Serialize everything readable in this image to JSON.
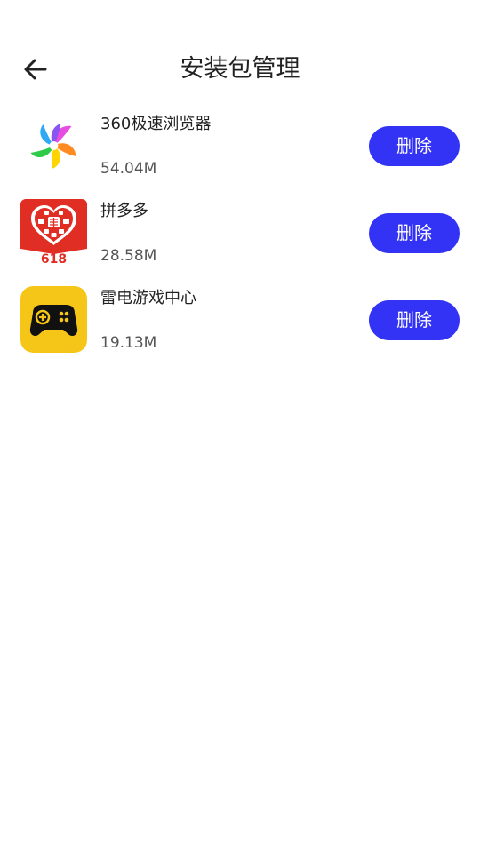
{
  "header": {
    "title": "安装包管理",
    "back_icon": "arrow-left-icon"
  },
  "colors": {
    "accent": "#3333f5",
    "pdd_red": "#e02e24",
    "ld_yellow": "#f5c518"
  },
  "apps": [
    {
      "name": "360极速浏览器",
      "size": "54.04M",
      "icon": "browser-360-icon",
      "action_label": "删除"
    },
    {
      "name": "拼多多",
      "size": "28.58M",
      "icon": "pinduoduo-icon",
      "badge": "618",
      "action_label": "删除"
    },
    {
      "name": "雷电游戏中心",
      "size": "19.13M",
      "icon": "gamepad-icon",
      "action_label": "删除"
    }
  ]
}
